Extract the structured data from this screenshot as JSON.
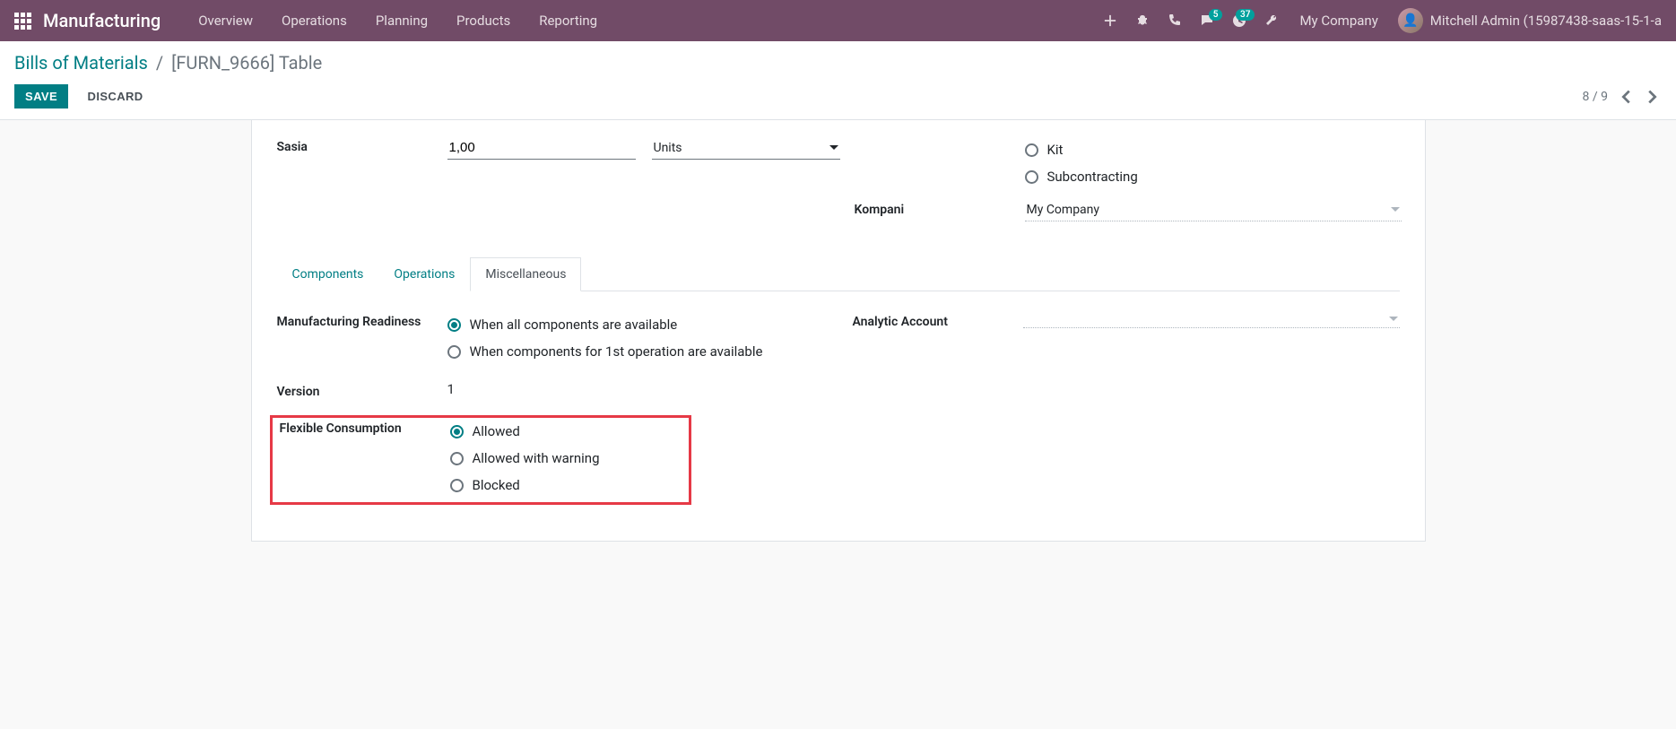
{
  "navbar": {
    "brand": "Manufacturing",
    "menu": [
      "Overview",
      "Operations",
      "Planning",
      "Products",
      "Reporting"
    ],
    "badges": {
      "messages": "5",
      "activities": "37"
    },
    "company": "My Company",
    "user": "Mitchell Admin (15987438-saas-15-1-a"
  },
  "breadcrumb": {
    "parent": "Bills of Materials",
    "current": "[FURN_9666] Table"
  },
  "buttons": {
    "save": "SAVE",
    "discard": "DISCARD"
  },
  "pager": {
    "current": "8",
    "total": "9"
  },
  "form": {
    "sasia": {
      "label": "Sasia",
      "qty": "1,00",
      "uom": "Units"
    },
    "type_options": {
      "kit": "Kit",
      "sub": "Subcontracting"
    },
    "kompani": {
      "label": "Kompani",
      "value": "My Company"
    }
  },
  "tabs": {
    "components": "Components",
    "operations": "Operations",
    "misc": "Miscellaneous"
  },
  "misc": {
    "readiness": {
      "label": "Manufacturing Readiness",
      "opt1": "When all components are available",
      "opt2": "When components for 1st operation are available"
    },
    "version": {
      "label": "Version",
      "value": "1"
    },
    "flex": {
      "label": "Flexible Consumption",
      "opt1": "Allowed",
      "opt2": "Allowed with warning",
      "opt3": "Blocked"
    },
    "analytic": {
      "label": "Analytic Account",
      "value": ""
    }
  }
}
